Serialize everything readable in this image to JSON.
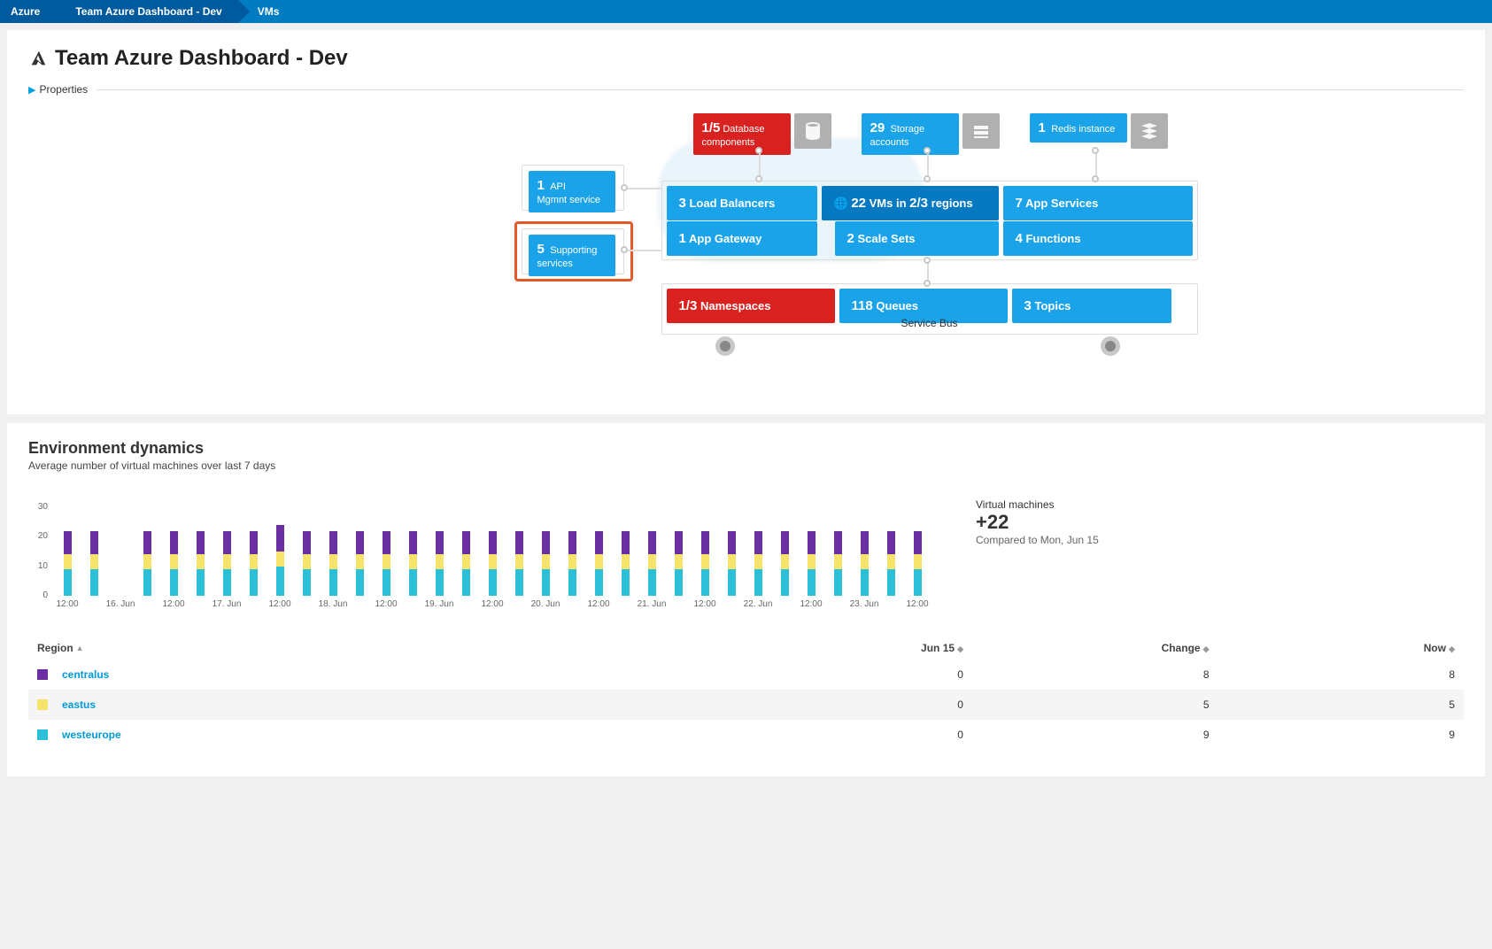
{
  "breadcrumb": [
    "Azure",
    "Team Azure Dashboard - Dev",
    "VMs"
  ],
  "pageTitle": "Team Azure Dashboard - Dev",
  "propertiesLabel": "Properties",
  "tiles": {
    "db": {
      "count": "1/5",
      "label": "Database components"
    },
    "stor": {
      "count": "29",
      "label": "Storage accounts"
    },
    "redis": {
      "count": "1",
      "label": "Redis instance"
    },
    "api": {
      "count": "1",
      "label1": "API",
      "label2": "Mgmnt service"
    },
    "supp": {
      "count": "5",
      "label1": "Supporting",
      "label2": "services"
    },
    "lb": {
      "count": "3",
      "label": "Load Balancers"
    },
    "gw": {
      "count": "1",
      "label": "App Gateway"
    },
    "vms": {
      "count": "22",
      "label1": "VMs in",
      "frac": "2/3",
      "label2": "regions"
    },
    "ss": {
      "count": "2",
      "label": "Scale Sets"
    },
    "apps": {
      "count": "7",
      "label": "App Services"
    },
    "func": {
      "count": "4",
      "label": "Functions"
    },
    "ns": {
      "count": "1/3",
      "label": "Namespaces"
    },
    "q": {
      "count": "118",
      "label": "Queues"
    },
    "top": {
      "count": "3",
      "label": "Topics"
    }
  },
  "serviceBusLabel": "Service Bus",
  "env": {
    "title": "Environment dynamics",
    "subtitle": "Average number of virtual machines over last 7 days",
    "summaryLabel": "Virtual machines",
    "summaryValue": "+22",
    "summaryCompare": "Compared to Mon, Jun 15"
  },
  "chart_data": {
    "type": "bar",
    "stacked": true,
    "ylim": [
      0,
      30
    ],
    "yticks": [
      0,
      10,
      20,
      30
    ],
    "xlabels": [
      "12:00",
      "16. Jun",
      "12:00",
      "17. Jun",
      "12:00",
      "18. Jun",
      "12:00",
      "19. Jun",
      "12:00",
      "20. Jun",
      "12:00",
      "21. Jun",
      "12:00",
      "22. Jun",
      "12:00",
      "23. Jun",
      "12:00"
    ],
    "categories_count": 33,
    "series": [
      {
        "name": "westeurope",
        "color": "#2bc0d8",
        "values": [
          9,
          9,
          0,
          9,
          9,
          9,
          9,
          9,
          10,
          9,
          9,
          9,
          9,
          9,
          9,
          9,
          9,
          9,
          9,
          9,
          9,
          9,
          9,
          9,
          9,
          9,
          9,
          9,
          9,
          9,
          9,
          9,
          9
        ]
      },
      {
        "name": "eastus",
        "color": "#f6e36b",
        "values": [
          5,
          5,
          0,
          5,
          5,
          5,
          5,
          5,
          5,
          5,
          5,
          5,
          5,
          5,
          5,
          5,
          5,
          5,
          5,
          5,
          5,
          5,
          5,
          5,
          5,
          5,
          5,
          5,
          5,
          5,
          5,
          5,
          5
        ]
      },
      {
        "name": "centralus",
        "color": "#6a2fa3",
        "values": [
          8,
          8,
          0,
          8,
          8,
          8,
          8,
          8,
          9,
          8,
          8,
          8,
          8,
          8,
          8,
          8,
          8,
          8,
          8,
          8,
          8,
          8,
          8,
          8,
          8,
          8,
          8,
          8,
          8,
          8,
          8,
          8,
          8
        ]
      }
    ]
  },
  "table": {
    "headers": {
      "region": "Region",
      "jun15": "Jun 15",
      "change": "Change",
      "now": "Now"
    },
    "rows": [
      {
        "color": "#6a2fa3",
        "region": "centralus",
        "jun15": "0",
        "change": "8",
        "now": "8"
      },
      {
        "color": "#f6e36b",
        "region": "eastus",
        "jun15": "0",
        "change": "5",
        "now": "5"
      },
      {
        "color": "#2bc0d8",
        "region": "westeurope",
        "jun15": "0",
        "change": "9",
        "now": "9"
      }
    ]
  }
}
